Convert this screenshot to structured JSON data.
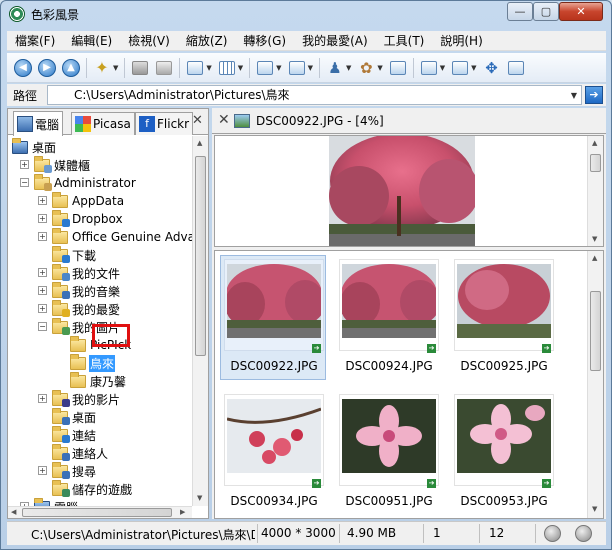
{
  "window": {
    "title": "色彩風景",
    "minimize": "—",
    "maximize": "▢",
    "close": "✕"
  },
  "menu": [
    "檔案(F)",
    "編輯(E)",
    "檢視(V)",
    "縮放(Z)",
    "轉移(G)",
    "我的最愛(A)",
    "工具(T)",
    "說明(H)"
  ],
  "toolbar": {
    "icons": [
      "back-icon",
      "forward-icon",
      "up-icon",
      "favorites-icon",
      "save-icon",
      "print-icon",
      "layout-icon",
      "view-mode-icon",
      "zoom-icon",
      "copy-icon",
      "user-icon",
      "color-icon",
      "fullscreen-icon",
      "minimize-pane-icon",
      "maximize-pane-icon",
      "fit-icon",
      "crop-icon"
    ]
  },
  "address": {
    "label": "路徑",
    "value": "C:\\Users\\Administrator\\Pictures\\鳥來"
  },
  "tabs": [
    {
      "label": "電腦",
      "icon": "computer-icon"
    },
    {
      "label": "Picasa",
      "icon": "picasa-icon"
    },
    {
      "label": "Flickr",
      "icon": "flickr-icon"
    }
  ],
  "tree": [
    {
      "label": "桌面",
      "level": 0,
      "expander": "",
      "icon": "desktop-icon"
    },
    {
      "label": "媒體櫃",
      "level": 1,
      "expander": "+",
      "icon": "library-icon"
    },
    {
      "label": "Administrator",
      "level": 1,
      "expander": "−",
      "icon": "user-folder-icon"
    },
    {
      "label": "AppData",
      "level": 2,
      "expander": "+",
      "icon": "folder-icon"
    },
    {
      "label": "Dropbox",
      "level": 2,
      "expander": "+",
      "icon": "dropbox-folder-icon"
    },
    {
      "label": "Office Genuine Adva",
      "level": 2,
      "expander": "+",
      "icon": "folder-icon"
    },
    {
      "label": "下載",
      "level": 2,
      "expander": "",
      "icon": "downloads-folder-icon"
    },
    {
      "label": "我的文件",
      "level": 2,
      "expander": "+",
      "icon": "documents-folder-icon"
    },
    {
      "label": "我的音樂",
      "level": 2,
      "expander": "+",
      "icon": "music-folder-icon"
    },
    {
      "label": "我的最愛",
      "level": 2,
      "expander": "+",
      "icon": "favorites-folder-icon"
    },
    {
      "label": "我的圖片",
      "level": 2,
      "expander": "−",
      "icon": "pictures-folder-icon"
    },
    {
      "label": "PicPIck",
      "level": 3,
      "expander": "",
      "icon": "folder-icon"
    },
    {
      "label": "鳥來",
      "level": 3,
      "expander": "",
      "icon": "folder-icon",
      "selected": true
    },
    {
      "label": "康乃馨",
      "level": 3,
      "expander": "",
      "icon": "folder-icon"
    },
    {
      "label": "我的影片",
      "level": 2,
      "expander": "+",
      "icon": "videos-folder-icon"
    },
    {
      "label": "桌面",
      "level": 2,
      "expander": "",
      "icon": "desktop-folder-icon"
    },
    {
      "label": "連結",
      "level": 2,
      "expander": "",
      "icon": "links-folder-icon"
    },
    {
      "label": "連絡人",
      "level": 2,
      "expander": "",
      "icon": "contacts-folder-icon"
    },
    {
      "label": "搜尋",
      "level": 2,
      "expander": "+",
      "icon": "search-folder-icon"
    },
    {
      "label": "儲存的遊戲",
      "level": 2,
      "expander": "",
      "icon": "games-folder-icon"
    },
    {
      "label": "電腦",
      "level": 1,
      "expander": "+",
      "icon": "computer-icon"
    }
  ],
  "preview": {
    "close": "✕",
    "title": "DSC00922.JPG - [4%]"
  },
  "thumbnails": [
    {
      "name": "DSC00922.JPG",
      "kind": "tree",
      "selected": true
    },
    {
      "name": "DSC00924.JPG",
      "kind": "tree"
    },
    {
      "name": "DSC00925.JPG",
      "kind": "tree2"
    },
    {
      "name": "DSC00934.JPG",
      "kind": "closeup"
    },
    {
      "name": "DSC00951.JPG",
      "kind": "blossom"
    },
    {
      "name": "DSC00953.JPG",
      "kind": "blossom2"
    }
  ],
  "status": {
    "path": "C:\\Users\\Administrator\\Pictures\\鳥來\\DS",
    "dimensions": "4000 * 3000",
    "size": "4.90 MB",
    "index": "1",
    "count": "12"
  }
}
